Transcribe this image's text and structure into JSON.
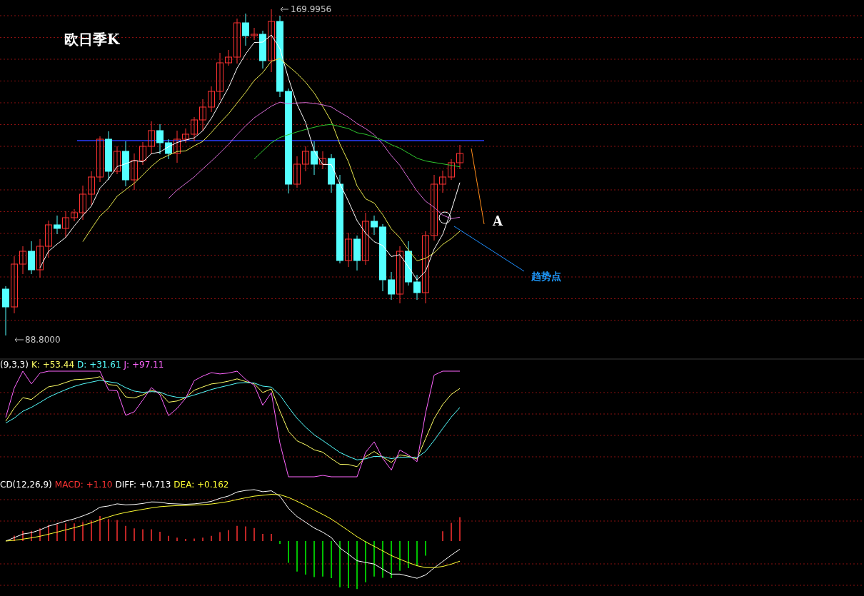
{
  "chart": {
    "title": "欧日季K",
    "max_label": "169.9956",
    "min_label": "88.8000",
    "annotation_mark": "A",
    "trend_label": "趋势点"
  },
  "kdj_header": [
    {
      "text": "(9,3,3)",
      "color": "#ffffff"
    },
    {
      "text": "K: +53.44",
      "color": "#ffff66"
    },
    {
      "text": "D: +31.61",
      "color": "#55ffff"
    },
    {
      "text": "J: +97.11",
      "color": "#ff66ff"
    }
  ],
  "macd_header": [
    {
      "text": "CD(12,26,9)",
      "color": "#ffffff"
    },
    {
      "text": "MACD: +1.10",
      "color": "#ff3333"
    },
    {
      "text": "DIFF: +0.713",
      "color": "#ffffff"
    },
    {
      "text": "DEA: +0.162",
      "color": "#ffff33"
    }
  ]
}
